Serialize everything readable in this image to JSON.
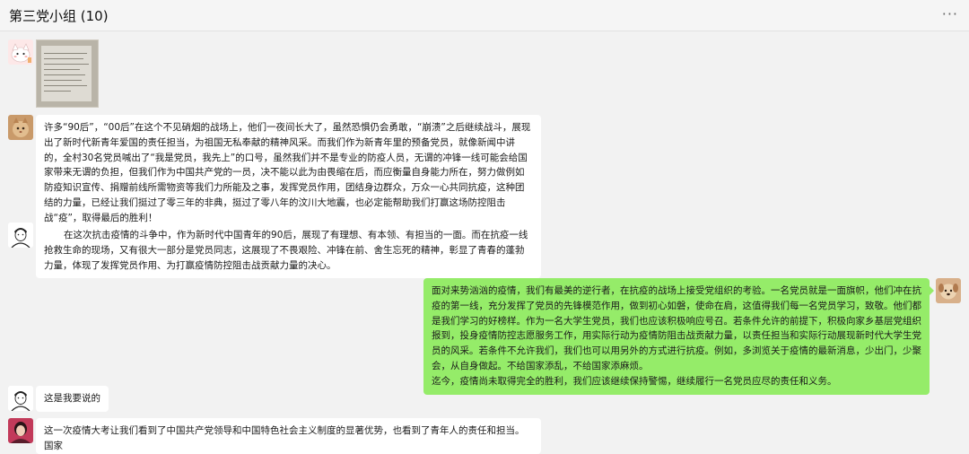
{
  "window": {
    "title": "第三党小组 (10)",
    "more_glyph": "···"
  },
  "messages": [
    {
      "id": "m1",
      "sender_avatar": "cat-cartoon-avatar",
      "type": "image",
      "image_icon": "handwritten-note-photo"
    },
    {
      "id": "m2",
      "sender_avatar": "cat-photo-avatar",
      "type": "text",
      "paragraphs": [
        "许多“90后”，“00后”在这个不见硝烟的战场上，他们一夜间长大了，虽然恐惧仍会勇敢，“崩溃”之后继续战斗，展现出了新时代新青年爱国的责任担当，为祖国无私奉献的精神风采。而我们作为新青年里的预备党员，就像新闻中讲的，全村30名党员喊出了“我是党员，我先上”的口号，虽然我们并不是专业的防疫人员，无谓的冲锋一线可能会给国家带来无谓的负担，但我们作为中国共产党的一员，决不能以此为由畏缩在后，而应衡量自身能力所在，努力做例如防疫知识宣传、捐赠前线所需物资等我们力所能及之事，发挥党员作用，团结身边群众，万众一心共同抗疫，这种团结的力量，已经让我们挺过了零三年的非典，挺过了零八年的汶川大地震，也必定能帮助我们打赢这场防控阻击战“疫”，取得最后的胜利！"
      ]
    },
    {
      "id": "m3",
      "sender_avatar": "sketch-portrait-avatar",
      "type": "text",
      "paragraphs": [
        "在这次抗击疫情的斗争中，作为新时代中国青年的90后，展现了有理想、有本领、有担当的一面。而在抗疫一线抢救生命的现场，又有很大一部分是党员同志，这展现了不畏艰险、冲锋在前、舍生忘死的精神，彰显了青春的蓬勃力量，体现了发挥党员作用、为打赢疫情防控阻击战贡献力量的决心。"
      ]
    },
    {
      "id": "m4",
      "sender_avatar": "dog-photo-avatar",
      "type": "text",
      "mine": true,
      "paragraphs": [
        "面对来势汹汹的疫情，我们有最美的逆行者，在抗疫的战场上接受党组织的考验。一名党员就是一面旗帜，他们冲在抗疫的第一线，充分发挥了党员的先锋模范作用，做到初心如磐，使命在肩，这值得我们每一名党员学习，致敬。他们都是我们学习的好榜样。作为一名大学生党员，我们也应该积极响应号召。若条件允许的前提下，积极向家乡基层党组织报到，投身疫情防控志愿服务工作，用实际行动为疫情防阻击战贡献力量，以责任担当和实际行动展现新时代大学生党员的风采。若条件不允许我们，我们也可以用另外的方式进行抗疫。例如，多浏览关于疫情的最新消息，少出门，少聚会，从自身做起。不给国家添乱，不给国家添麻烦。",
        "迄今，疫情尚未取得完全的胜利，我们应该继续保持警惕，继续履行一名党员应尽的责任和义务。"
      ]
    },
    {
      "id": "m5",
      "sender_avatar": "sketch-portrait-avatar",
      "type": "text",
      "paragraphs": [
        "这是我要说的"
      ]
    },
    {
      "id": "m6",
      "sender_avatar": "woman-photo-avatar",
      "type": "text",
      "paragraphs": [
        "这一次疫情大考让我们看到了中国共产党领导和中国特色社会主义制度的显著优势，也看到了青年人的责任和担当。国家"
      ]
    }
  ]
}
